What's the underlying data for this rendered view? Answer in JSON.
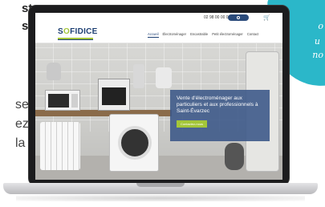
{
  "side_text": {
    "line1": "st",
    "line2": "st",
    "line3": "se",
    "line4": "ez",
    "line5": "la"
  },
  "teal_card": {
    "line1": "o",
    "line2": "u",
    "line3": "no"
  },
  "site": {
    "phone": "02 98 00 00 00",
    "logo_prefix": "S",
    "logo_o": "O",
    "logo_suffix": "FIDICE",
    "nav": [
      "Accueil",
      "Électroménager",
      "Encastrable",
      "Petit électroménager",
      "Contact"
    ],
    "hero_title": "Vente d'électroménager aux particuliers et aux professionnels à Saint-Évarzec",
    "hero_cta": "Contactez-nous",
    "cart_icon": "cart-icon",
    "search_icon": "search-icon"
  },
  "colors": {
    "brand_blue": "#1d3f73",
    "brand_green": "#a4c639",
    "teal": "#2bb7c9",
    "hero_overlay": "#3a5687"
  }
}
